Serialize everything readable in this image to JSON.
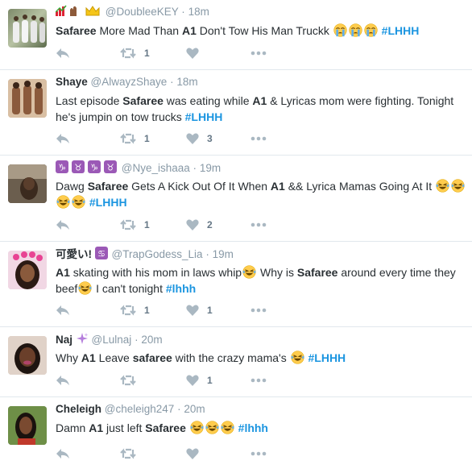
{
  "tweets": [
    {
      "name": "",
      "name_suffix": "",
      "handle": "@DoubleeKEY",
      "time": "18m",
      "segments": [
        {
          "t": "Safaree",
          "k": "hl"
        },
        {
          "t": " More Mad Than ",
          "k": "n"
        },
        {
          "t": "A1",
          "k": "hl"
        },
        {
          "t": " Don't Tow His Man Truckk ",
          "k": "n"
        },
        {
          "t": "😭",
          "k": "e"
        },
        {
          "t": "😭",
          "k": "e"
        },
        {
          "t": "😭",
          "k": "e"
        },
        {
          "t": " ",
          "k": "n"
        },
        {
          "t": "#LHHH",
          "k": "tag"
        }
      ],
      "retweets": "1",
      "likes": ""
    },
    {
      "name": "Shaye",
      "handle": "@AlwayzShaye",
      "time": "18m",
      "segments": [
        {
          "t": "Last episode ",
          "k": "n"
        },
        {
          "t": "Safaree",
          "k": "hl"
        },
        {
          "t": " was eating while ",
          "k": "n"
        },
        {
          "t": "A1",
          "k": "hl"
        },
        {
          "t": " & Lyricas mom were fighting. Tonight he's jumpin on tow trucks ",
          "k": "n"
        },
        {
          "t": "#LHHH",
          "k": "tag"
        }
      ],
      "retweets": "1",
      "likes": "3"
    },
    {
      "name": "",
      "handle": "@Nye_ishaaa",
      "time": "19m",
      "segments": [
        {
          "t": "Dawg ",
          "k": "n"
        },
        {
          "t": "Safaree",
          "k": "hl"
        },
        {
          "t": " Gets A Kick Out Of It When ",
          "k": "n"
        },
        {
          "t": "A1",
          "k": "hl"
        },
        {
          "t": " && Lyrica Mamas Going At It ",
          "k": "n"
        },
        {
          "t": "😂",
          "k": "e"
        },
        {
          "t": "😂",
          "k": "e"
        },
        {
          "t": "😂",
          "k": "e"
        },
        {
          "t": "😂",
          "k": "e"
        },
        {
          "t": " ",
          "k": "n"
        },
        {
          "t": "#LHHH",
          "k": "tag"
        }
      ],
      "retweets": "1",
      "likes": "2"
    },
    {
      "name": "可愛い!",
      "handle": "@TrapGodess_Lia",
      "time": "19m",
      "segments": [
        {
          "t": "A1",
          "k": "hl"
        },
        {
          "t": " skating with his mom in laws whip",
          "k": "n"
        },
        {
          "t": "😂",
          "k": "e"
        },
        {
          "t": " Why is ",
          "k": "n"
        },
        {
          "t": "Safaree",
          "k": "hl"
        },
        {
          "t": " around every time they beef",
          "k": "n"
        },
        {
          "t": "😂",
          "k": "e"
        },
        {
          "t": " I can't tonight ",
          "k": "n"
        },
        {
          "t": "#lhhh",
          "k": "tag"
        }
      ],
      "retweets": "1",
      "likes": "1"
    },
    {
      "name": "Naj",
      "handle": "@Lulnaj",
      "time": "20m",
      "segments": [
        {
          "t": "Why ",
          "k": "n"
        },
        {
          "t": "A1",
          "k": "hl"
        },
        {
          "t": " Leave ",
          "k": "n"
        },
        {
          "t": "safaree",
          "k": "hl"
        },
        {
          "t": " with the crazy mama's ",
          "k": "n"
        },
        {
          "t": "😂",
          "k": "e"
        },
        {
          "t": " ",
          "k": "n"
        },
        {
          "t": "#LHHH",
          "k": "tag"
        }
      ],
      "retweets": "",
      "likes": "1"
    },
    {
      "name": "Cheleigh",
      "handle": "@cheleigh247",
      "time": "20m",
      "segments": [
        {
          "t": "Damn ",
          "k": "n"
        },
        {
          "t": "A1",
          "k": "hl"
        },
        {
          "t": " just left ",
          "k": "n"
        },
        {
          "t": "Safaree",
          "k": "hl"
        },
        {
          "t": " ",
          "k": "n"
        },
        {
          "t": "😂",
          "k": "e"
        },
        {
          "t": "😂",
          "k": "e"
        },
        {
          "t": "😂",
          "k": "e"
        },
        {
          "t": " ",
          "k": "n"
        },
        {
          "t": "#lhhh",
          "k": "tag"
        }
      ],
      "retweets": "",
      "likes": ""
    }
  ],
  "colors": {
    "hashtag": "#1b95e0",
    "meta": "#8899a6",
    "action": "#aab8c2",
    "divider": "#e1e8ed"
  },
  "icons": [
    "reply-icon",
    "retweet-icon",
    "like-icon",
    "more-icon",
    "sob-emoji",
    "laughing-emoji"
  ]
}
